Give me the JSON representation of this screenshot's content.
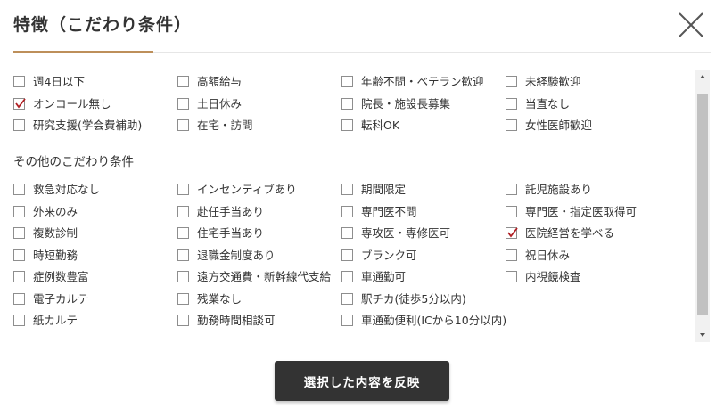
{
  "modal": {
    "title": "特徴（こだわり条件）",
    "close_icon": "close-x-icon",
    "accent_color": "#bd8f5a",
    "check_color": "#b01f24"
  },
  "primary_rows": [
    [
      {
        "label": "週4日以下",
        "checked": false
      },
      {
        "label": "高額給与",
        "checked": false
      },
      {
        "label": "年齢不問・ベテラン歓迎",
        "checked": false
      },
      {
        "label": "未経験歓迎",
        "checked": false
      }
    ],
    [
      {
        "label": "オンコール無し",
        "checked": true
      },
      {
        "label": "土日休み",
        "checked": false
      },
      {
        "label": "院長・施設長募集",
        "checked": false
      },
      {
        "label": "当直なし",
        "checked": false
      }
    ],
    [
      {
        "label": "研究支援(学会費補助)",
        "checked": false
      },
      {
        "label": "在宅・訪問",
        "checked": false
      },
      {
        "label": "転科OK",
        "checked": false
      },
      {
        "label": "女性医師歓迎",
        "checked": false
      }
    ]
  ],
  "other_section": {
    "title": "その他のこだわり条件",
    "rows": [
      [
        {
          "label": "救急対応なし",
          "checked": false
        },
        {
          "label": "インセンティブあり",
          "checked": false
        },
        {
          "label": "期間限定",
          "checked": false
        },
        {
          "label": "託児施設あり",
          "checked": false
        }
      ],
      [
        {
          "label": "外来のみ",
          "checked": false
        },
        {
          "label": "赴任手当あり",
          "checked": false
        },
        {
          "label": "専門医不問",
          "checked": false
        },
        {
          "label": "専門医・指定医取得可",
          "checked": false
        }
      ],
      [
        {
          "label": "複数診制",
          "checked": false
        },
        {
          "label": "住宅手当あり",
          "checked": false
        },
        {
          "label": "専攻医・専修医可",
          "checked": false
        },
        {
          "label": "医院経営を学べる",
          "checked": true
        }
      ],
      [
        {
          "label": "時短勤務",
          "checked": false
        },
        {
          "label": "退職金制度あり",
          "checked": false
        },
        {
          "label": "ブランク可",
          "checked": false
        },
        {
          "label": "祝日休み",
          "checked": false
        }
      ],
      [
        {
          "label": "症例数豊富",
          "checked": false
        },
        {
          "label": "遠方交通費・新幹線代支給",
          "checked": false
        },
        {
          "label": "車通勤可",
          "checked": false
        },
        {
          "label": "内視鏡検査",
          "checked": false
        }
      ],
      [
        {
          "label": "電子カルテ",
          "checked": false
        },
        {
          "label": "残業なし",
          "checked": false
        },
        {
          "label": "駅チカ(徒歩5分以内)",
          "checked": false
        }
      ],
      [
        {
          "label": "紙カルテ",
          "checked": false
        },
        {
          "label": "勤務時間相談可",
          "checked": false
        },
        {
          "label": "車通勤便利(ICから10分以内)",
          "checked": false
        }
      ]
    ]
  },
  "scrollbar": {
    "up_icon": "scroll-up-arrow-icon",
    "down_icon": "scroll-down-arrow-icon"
  },
  "footer": {
    "apply_label": "選択した内容を反映"
  }
}
